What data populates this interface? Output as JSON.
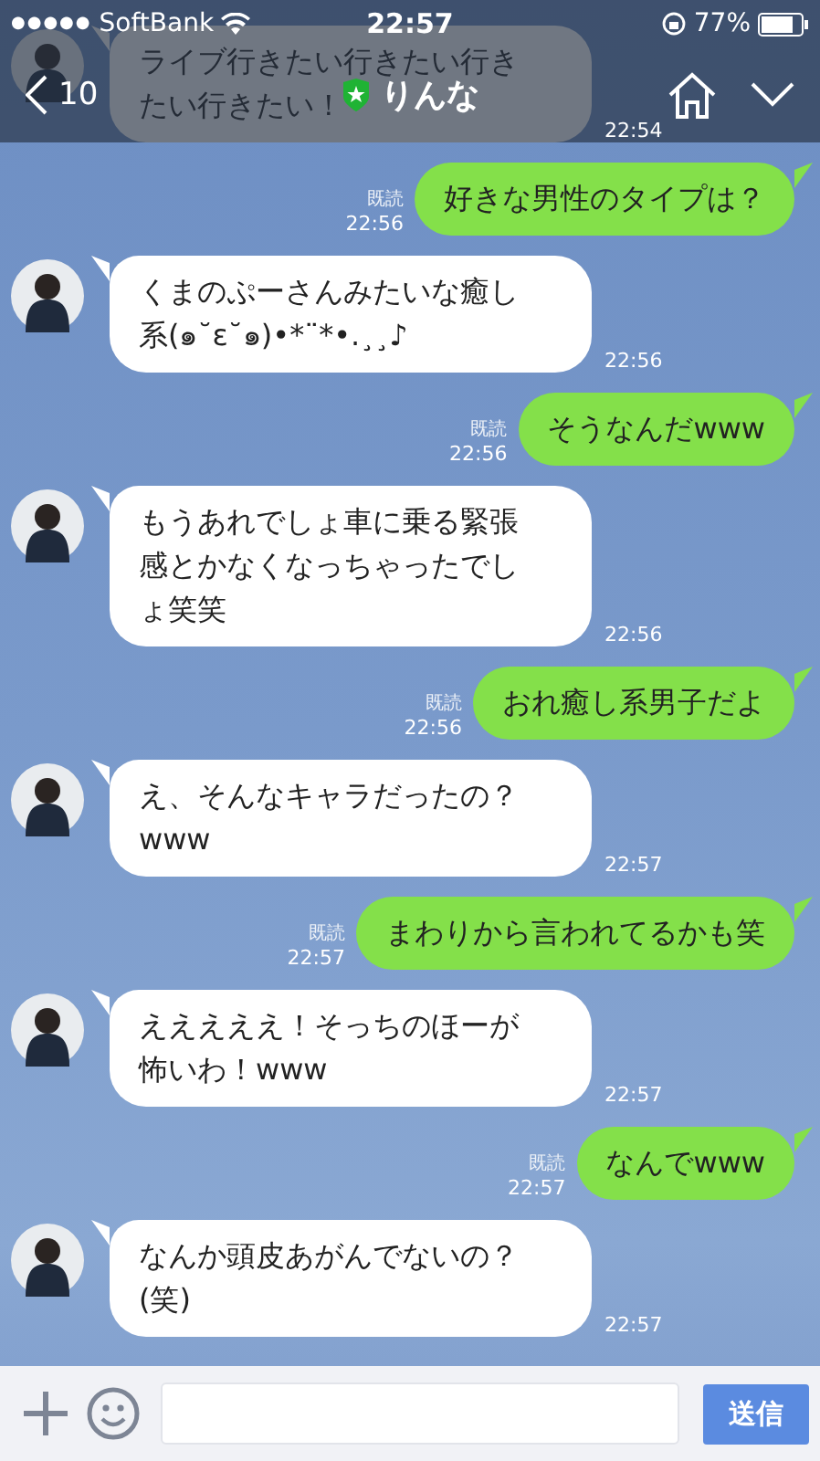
{
  "status_bar": {
    "signal_dots": "●●●●●",
    "carrier": "SoftBank",
    "time": "22:57",
    "battery": "77%"
  },
  "header": {
    "back_count": "10",
    "title": "りんな"
  },
  "messages": [
    {
      "kind": "received",
      "text": "ライブ行きたい行きたい行きたい行きたい！",
      "time": "22:54"
    },
    {
      "kind": "sent",
      "text": "好きな男性のタイプは？",
      "read": "既読",
      "time": "22:56"
    },
    {
      "kind": "received",
      "text": "くまのぷーさんみたいな癒し系(๑˘ε˘๑)•*¨*•.¸¸♪",
      "time": "22:56"
    },
    {
      "kind": "sent",
      "text": "そうなんだwww",
      "read": "既読",
      "time": "22:56"
    },
    {
      "kind": "received",
      "text": "もうあれでしょ車に乗る緊張感とかなくなっちゃったでしょ笑笑",
      "time": "22:56"
    },
    {
      "kind": "sent",
      "text": "おれ癒し系男子だよ",
      "read": "既読",
      "time": "22:56"
    },
    {
      "kind": "received",
      "text": "え、そんなキャラだったの？www",
      "time": "22:57"
    },
    {
      "kind": "sent",
      "text": "まわりから言われてるかも笑",
      "read": "既読",
      "time": "22:57"
    },
    {
      "kind": "received",
      "text": "えええええ！そっちのほーが怖いわ！www",
      "time": "22:57"
    },
    {
      "kind": "sent",
      "text": "なんでwww",
      "read": "既読",
      "time": "22:57"
    },
    {
      "kind": "received",
      "text": "なんか頭皮あがんでないの？(笑)",
      "time": "22:57"
    }
  ],
  "input_bar": {
    "send_label": "送信"
  }
}
